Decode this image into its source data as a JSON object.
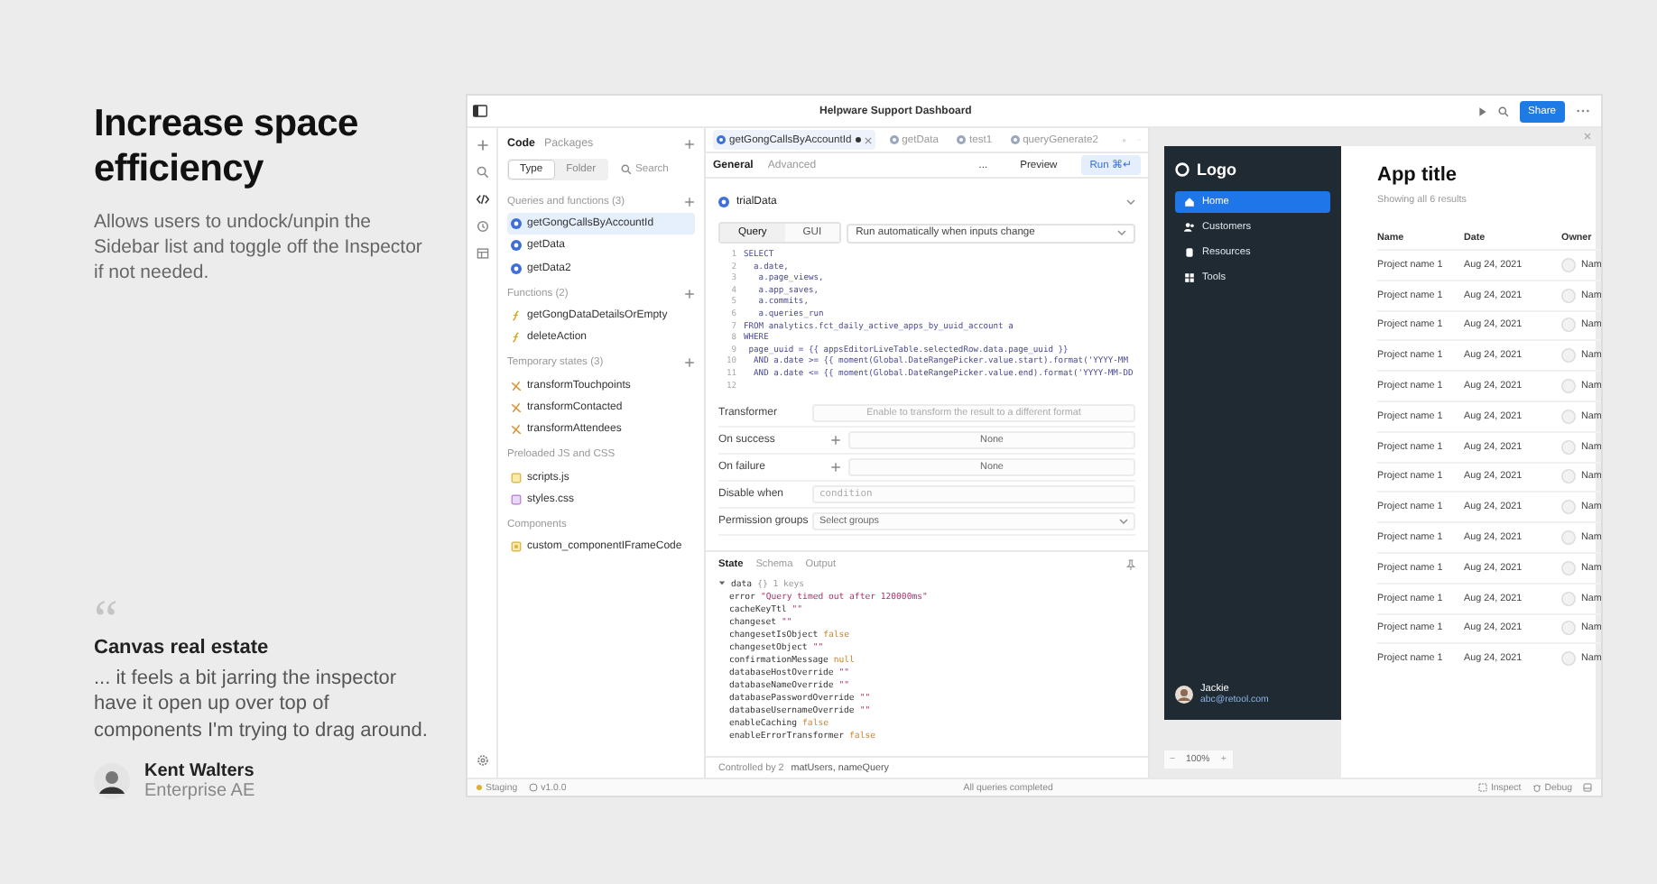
{
  "promo": {
    "title": "Increase space efficiency",
    "description": "Allows users to undock/unpin the Sidebar list and toggle off the Inspector if not needed.",
    "quote": {
      "mark": "“",
      "title": "Canvas real estate",
      "text": "... it feels a bit jarring the inspector have it open up over top of components I'm trying to drag around.",
      "author": "Kent Walters",
      "role": "Enterprise AE"
    }
  },
  "window": {
    "title": "Helpware Support Dashboard",
    "share": "Share"
  },
  "sidebar": {
    "tabs": [
      {
        "label": "Code",
        "selected": true
      },
      {
        "label": "Packages",
        "selected": false
      }
    ],
    "filters": [
      {
        "label": "Type",
        "selected": true
      },
      {
        "label": "Folder",
        "selected": false
      }
    ],
    "search": {
      "placeholder": "Search"
    },
    "sections": [
      {
        "title": "Queries and functions (3)",
        "addable": true,
        "items": [
          {
            "label": "getGongCallsByAccountId",
            "kind": "query",
            "selected": true
          },
          {
            "label": "getData",
            "kind": "query",
            "selected": false
          },
          {
            "label": "getData2",
            "kind": "query",
            "selected": false
          }
        ]
      },
      {
        "title": "Functions (2)",
        "addable": true,
        "items": [
          {
            "label": "getGongDataDetailsOrEmpty",
            "kind": "function",
            "selected": false
          },
          {
            "label": "deleteAction",
            "kind": "function",
            "selected": false
          }
        ]
      },
      {
        "title": "Temporary states (3)",
        "addable": true,
        "items": [
          {
            "label": "transformTouchpoints",
            "kind": "state",
            "selected": false
          },
          {
            "label": "transformContacted",
            "kind": "state",
            "selected": false
          },
          {
            "label": "transformAttendees",
            "kind": "state",
            "selected": false
          }
        ]
      },
      {
        "title": "Preloaded JS and CSS",
        "addable": false,
        "items": [
          {
            "label": "scripts.js",
            "kind": "js",
            "selected": false
          },
          {
            "label": "styles.css",
            "kind": "css",
            "selected": false
          }
        ]
      },
      {
        "title": "Components",
        "addable": false,
        "items": [
          {
            "label": "custom_componentIFrameCode",
            "kind": "component",
            "selected": false
          }
        ]
      }
    ]
  },
  "editor": {
    "tabs": [
      {
        "label": "getGongCallsByAccountId",
        "selected": true,
        "modified": true
      },
      {
        "label": "getData",
        "selected": false,
        "modified": false
      },
      {
        "label": "test1",
        "selected": false,
        "modified": false
      },
      {
        "label": "queryGenerate2",
        "selected": false,
        "modified": false
      }
    ],
    "subtabs": [
      {
        "label": "General",
        "selected": true
      },
      {
        "label": "Advanced",
        "selected": false
      }
    ],
    "more": "...",
    "preview": "Preview",
    "run": "Run ⌘↵",
    "resource": "trialData",
    "modes": [
      {
        "label": "Query",
        "selected": true
      },
      {
        "label": "GUI",
        "selected": false
      }
    ],
    "trigger": "Run automatically when inputs change",
    "code": [
      {
        "number": "1",
        "text": "SELECT"
      },
      {
        "number": "2",
        "text": "  a.date,"
      },
      {
        "number": "3",
        "text": "   a.page_views,"
      },
      {
        "number": "4",
        "text": "   a.app_saves,"
      },
      {
        "number": "5",
        "text": "   a.commits,"
      },
      {
        "number": "6",
        "text": "   a.queries_run"
      },
      {
        "number": "7",
        "text": "FROM analytics.fct_daily_active_apps_by_uuid_account a"
      },
      {
        "number": "8",
        "text": "WHERE"
      },
      {
        "number": "9",
        "text": " page_uuid = {{ appsEditorLiveTable.selectedRow.data.page_uuid }}"
      },
      {
        "number": "10",
        "text": "  AND a.date >= {{ moment(Global.DateRangePicker.value.start).format('YYYY-MM"
      },
      {
        "number": "11",
        "text": "  AND a.date <= {{ moment(Global.DateRangePicker.value.end).format('YYYY-MM-DD"
      },
      {
        "number": "12"
      }
    ],
    "fields": [
      {
        "label": "Transformer",
        "kind": "input",
        "placeholder": "Enable to transform the result to a different format"
      },
      {
        "label": "On success",
        "kind": "event",
        "value": "None"
      },
      {
        "label": "On failure",
        "kind": "event",
        "value": "None"
      },
      {
        "label": "Disable when",
        "kind": "code",
        "placeholder": "condition"
      },
      {
        "label": "Permission groups",
        "kind": "select",
        "value": "Select groups"
      }
    ],
    "state": {
      "tabs": [
        {
          "label": "State",
          "selected": true
        },
        {
          "label": "Schema",
          "selected": false
        },
        {
          "label": "Output",
          "selected": false
        }
      ],
      "root": {
        "key": "data",
        "summary": "{} 1 keys",
        "expanded": true
      },
      "entries": [
        {
          "key": "error",
          "value": "\"Query timed out after 120000ms\"",
          "kind": "string"
        },
        {
          "key": "cacheKeyTtl",
          "value": "\"\"",
          "kind": "string"
        },
        {
          "key": "changeset",
          "value": "\"\"",
          "kind": "string"
        },
        {
          "key": "changesetIsObject",
          "value": "false",
          "kind": "boolean"
        },
        {
          "key": "changesetObject",
          "value": "\"\"",
          "kind": "string"
        },
        {
          "key": "confirmationMessage",
          "value": "null",
          "kind": "null"
        },
        {
          "key": "databaseHostOverride",
          "value": "\"\"",
          "kind": "string"
        },
        {
          "key": "databaseNameOverride",
          "value": "\"\"",
          "kind": "string"
        },
        {
          "key": "databasePasswordOverride",
          "value": "\"\"",
          "kind": "string"
        },
        {
          "key": "databaseUsernameOverride",
          "value": "\"\"",
          "kind": "string"
        },
        {
          "key": "enableCaching",
          "value": "false",
          "kind": "boolean"
        },
        {
          "key": "enableErrorTransformer",
          "value": "false",
          "kind": "boolean"
        }
      ]
    },
    "controlled_by": {
      "label": "Controlled by 2",
      "value": "matUsers, nameQuery"
    }
  },
  "preview": {
    "logo": "Logo",
    "nav": [
      {
        "label": "Home",
        "kind": "home",
        "selected": true
      },
      {
        "label": "Customers",
        "kind": "people",
        "selected": false
      },
      {
        "label": "Resources",
        "kind": "database",
        "selected": false
      },
      {
        "label": "Tools",
        "kind": "grid",
        "selected": false
      }
    ],
    "user": {
      "name": "Jackie",
      "email": "abc@retool.com"
    },
    "title": "App title",
    "subtitle": "Showing all 6 results",
    "columns": [
      "Name",
      "Date",
      "Owner"
    ],
    "rows": [
      {
        "name": "Project name 1",
        "date": "Aug 24, 2021",
        "owner": "Nam"
      },
      {
        "name": "Project name 1",
        "date": "Aug 24, 2021",
        "owner": "Nam"
      },
      {
        "name": "Project name 1",
        "date": "Aug 24, 2021",
        "owner": "Nam"
      },
      {
        "name": "Project name 1",
        "date": "Aug 24, 2021",
        "owner": "Nam"
      },
      {
        "name": "Project name 1",
        "date": "Aug 24, 2021",
        "owner": "Nam"
      },
      {
        "name": "Project name 1",
        "date": "Aug 24, 2021",
        "owner": "Nam"
      },
      {
        "name": "Project name 1",
        "date": "Aug 24, 2021",
        "owner": "Nam"
      },
      {
        "name": "Project name 1",
        "date": "Aug 24, 2021",
        "owner": "Nam"
      },
      {
        "name": "Project name 1",
        "date": "Aug 24, 2021",
        "owner": "Nam"
      },
      {
        "name": "Project name 1",
        "date": "Aug 24, 2021",
        "owner": "Nam"
      },
      {
        "name": "Project name 1",
        "date": "Aug 24, 2021",
        "owner": "Nam"
      },
      {
        "name": "Project name 1",
        "date": "Aug 24, 2021",
        "owner": "Nam"
      },
      {
        "name": "Project name 1",
        "date": "Aug 24, 2021",
        "owner": "Nam"
      },
      {
        "name": "Project name 1",
        "date": "Aug 24, 2021",
        "owner": "Nam"
      }
    ],
    "zoom": {
      "minus": "−",
      "value": "100%",
      "plus": "+"
    }
  },
  "status_bar": {
    "environment": "Staging",
    "version": "v1.0.0",
    "message": "All queries completed",
    "inspect": "Inspect",
    "debug": "Debug"
  }
}
